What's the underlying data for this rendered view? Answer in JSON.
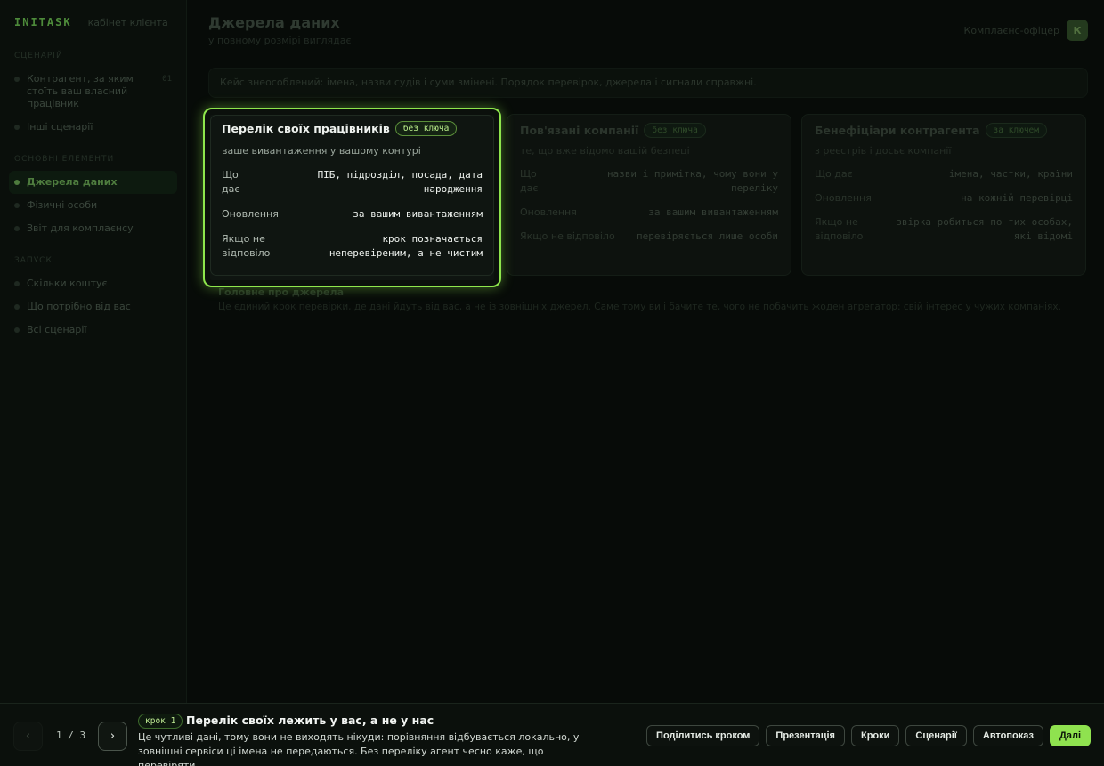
{
  "brand": {
    "logo": "INITASK",
    "sub": "кабінет клієнта"
  },
  "sidebar": {
    "groups": [
      {
        "label": "СЦЕНАРІЙ",
        "items": [
          {
            "label": "Контрагент, за яким стоїть ваш власний працівник",
            "num": "01"
          },
          {
            "label": "Інші сценарії",
            "num": ""
          }
        ]
      },
      {
        "label": "ОСНОВНІ ЕЛЕМЕНТИ",
        "items": [
          {
            "label": "Джерела даних",
            "num": "",
            "active": true
          },
          {
            "label": "Фізичні особи",
            "num": ""
          },
          {
            "label": "Звіт для комплаєнсу",
            "num": ""
          }
        ]
      },
      {
        "label": "ЗАПУСК",
        "items": [
          {
            "label": "Скільки коштує",
            "num": ""
          },
          {
            "label": "Що потрібно від вас",
            "num": ""
          },
          {
            "label": "Всі сценарії",
            "num": ""
          }
        ]
      }
    ]
  },
  "header": {
    "title": "Джерела даних",
    "subtitle": "у повному розмірі виглядає",
    "user_name": "Комплаєнс-офіцер",
    "avatar": "К"
  },
  "notice": "Кейс знеособлений: імена, назви судів і суми змінені. Порядок перевірок, джерела і сигнали справжні.",
  "cards": [
    {
      "title": "Перелік своїх працівників",
      "badge": "без ключа",
      "subtitle": "ваше вивантаження у вашому контурі",
      "rows": [
        {
          "k": "Що дає",
          "v": "ПІБ, підрозділ, посада, дата народження"
        },
        {
          "k": "Оновлення",
          "v": "за вашим вивантаженням"
        },
        {
          "k": "Якщо не відповіло",
          "v": "крок позначається неперевіреним, а не чистим"
        }
      ]
    },
    {
      "title": "Пов'язані компанії",
      "badge": "без ключа",
      "subtitle": "те, що вже відомо вашій безпеці",
      "rows": [
        {
          "k": "Що дає",
          "v": "назви і примітка, чому вони у переліку"
        },
        {
          "k": "Оновлення",
          "v": "за вашим вивантаженням"
        },
        {
          "k": "Якщо не відповіло",
          "v": "перевіряється лише особи"
        }
      ]
    },
    {
      "title": "Бенефіціари контрагента",
      "badge": "за ключем",
      "subtitle": "з реєстрів і досьє компанії",
      "rows": [
        {
          "k": "Що дає",
          "v": "імена, частки, країни"
        },
        {
          "k": "Оновлення",
          "v": "на кожній перевірці"
        },
        {
          "k": "Якщо не відповіло",
          "v": "звірка робиться по тих особах, які відомі"
        }
      ]
    }
  ],
  "footnote": {
    "title": "Головне про джерела",
    "text": "Це єдиний крок перевірки, де дані йдуть від вас, а не із зовнішніх джерел. Саме тому ви і бачите те, чого не побачить жоден агрегатор: свій інтерес у чужих компаніях."
  },
  "bottom": {
    "prev_icon": "‹",
    "next_icon": "›",
    "counter": "1 / 3",
    "step_badge": "крок 1",
    "step_title": "Перелік своїх лежить у вас, а не у нас",
    "step_text": "Це чутливі дані, тому вони не виходять нікуди: порівняння відбувається локально, у зовнішні сервіси ці імена не передаються. Без переліку агент чесно каже, що перевіряти…",
    "buttons": {
      "share": "Поділитись кроком",
      "present": "Презентація",
      "steps": "Кроки",
      "scenarios": "Сценарії",
      "autoplay": "Автопоказ",
      "next": "Далі"
    }
  },
  "colors": {
    "accent": "#8fe24f",
    "background": "#070b08"
  }
}
